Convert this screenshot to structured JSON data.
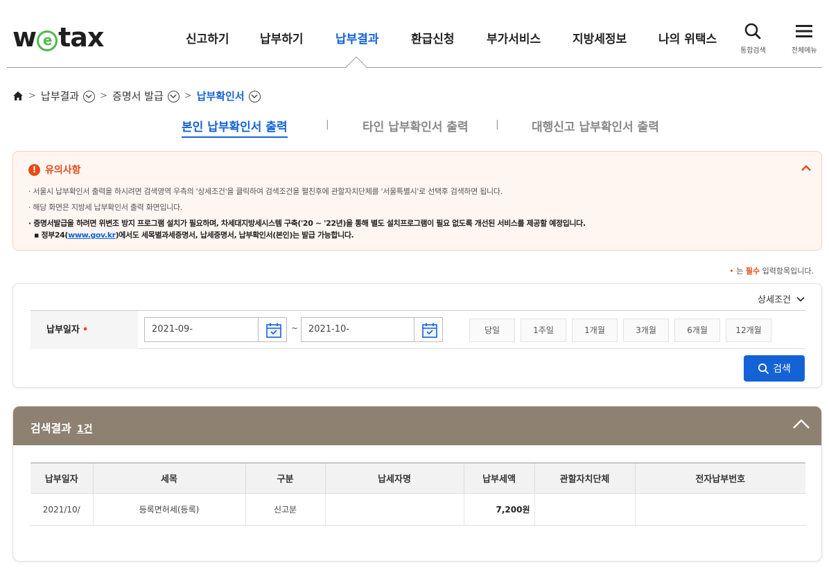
{
  "header": {
    "logo": {
      "pre": "w",
      "circle": "e",
      "post": "tax"
    },
    "nav": [
      "신고하기",
      "납부하기",
      "납부결과",
      "환급신청",
      "부가서비스",
      "지방세정보",
      "나의 위택스"
    ],
    "active_nav": "납부결과",
    "search_label": "통합검색",
    "menu_label": "전체메뉴"
  },
  "breadcrumb": {
    "items": [
      "납부결과",
      "증명서 발급",
      "납부확인서"
    ]
  },
  "subtabs": [
    "본인 납부확인서 출력",
    "타인 납부확인서 출력",
    "대행신고 납부확인서 출력"
  ],
  "notice": {
    "title": "유의사항",
    "lines": [
      "· 서울시 납부확인서 출력을 하시려면 검색영역 우측의 '상세조건'을 클릭하여 검색조건을 펼친후에 관할자치단체를 '서울특별시'로 선택후 검색하면 됩니다.",
      "· 해당 화면은 지방세 납부확인서 출력 화면입니다.",
      "· 증명서발급을 하려면 위변조 방지 프로그램 설치가 필요하며, 차세대지방세시스템 구축('20 ~ '22년)을 통해 별도 설치프로그램이 필요 없도록 개선된 서비스를 제공할 예정입니다."
    ],
    "gov_pre": "▪ 정부24(",
    "gov_link": "www.gov.kr",
    "gov_post": ")에서도 세목별과세증명서, 납세증명서, 납부확인서(본인)는 발급 가능합니다."
  },
  "required_note": {
    "dot": "•",
    "pre": " 는 ",
    "req": "필수",
    "post": " 입력항목입니다."
  },
  "search": {
    "detail_label": "상세조건",
    "field_label": "납부일자",
    "required_mark": "•",
    "from_date": "2021-09-",
    "to_date": "2021-10-",
    "tilde": "~",
    "periods": [
      "당일",
      "1주일",
      "1개월",
      "3개월",
      "6개월",
      "12개월"
    ],
    "search_button": "검색"
  },
  "results": {
    "title": "검색결과",
    "count": "1건",
    "columns": [
      "납부일자",
      "세목",
      "구분",
      "납세자명",
      "납부세액",
      "관할자치단체",
      "전자납부번호"
    ],
    "rows": [
      {
        "date": "2021/10/",
        "tax_item": "등록면허세(등록)",
        "type": "신고분",
        "payer": "",
        "amount": "7,200원",
        "authority": "",
        "e_number": ""
      }
    ]
  },
  "colors": {
    "accent": "#1463d6",
    "warning": "#e54b14",
    "results_header": "#8e8172",
    "logo_green": "#4fb84d"
  }
}
